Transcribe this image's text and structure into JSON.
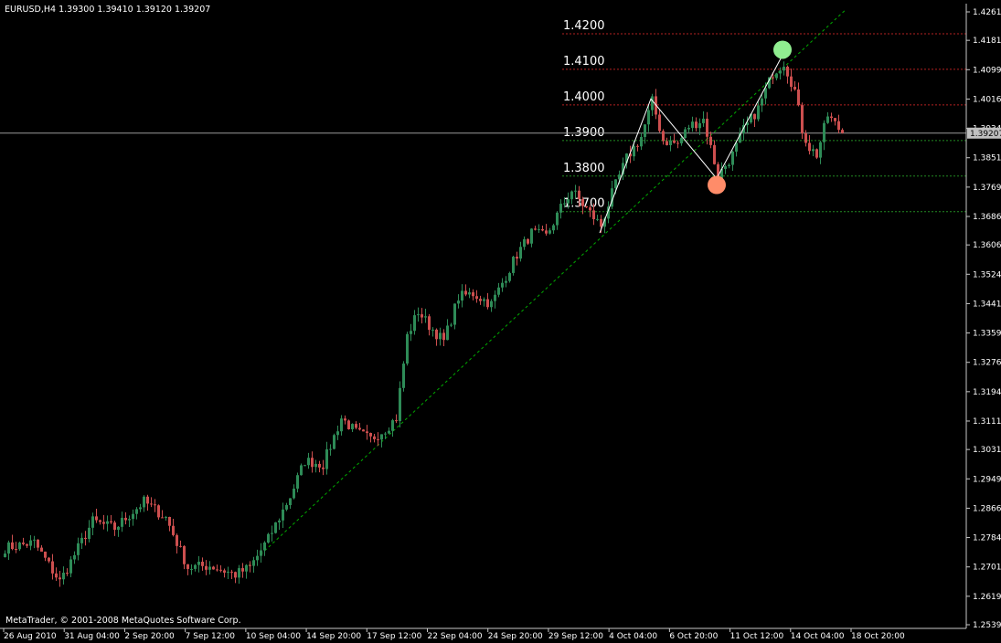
{
  "chart_data": {
    "type": "candlestick",
    "symbol_header": "EURUSD,H4  1.39300 1.39410 1.39120 1.39207",
    "footer": "MetaTrader, © 2001-2008 MetaQuotes Software Corp.",
    "y_axis_ticks": [
      "1.42615",
      "1.41815",
      "1.40990",
      "1.40165",
      "1.39340",
      "1.38515",
      "1.37690",
      "1.36865",
      "1.36065",
      "1.35240",
      "1.34415",
      "1.33590",
      "1.32765",
      "1.31940",
      "1.31115",
      "1.30315",
      "1.29490",
      "1.28665",
      "1.27840",
      "1.27015",
      "1.26190",
      "1.25390"
    ],
    "x_axis_ticks": [
      "26 Aug 2010",
      "31 Aug 04:00",
      "2 Sep 20:00",
      "7 Sep 12:00",
      "10 Sep 04:00",
      "14 Sep 20:00",
      "17 Sep 12:00",
      "22 Sep 04:00",
      "24 Sep 20:00",
      "29 Sep 12:00",
      "4 Oct 04:00",
      "6 Oct 20:00",
      "11 Oct 12:00",
      "14 Oct 04:00",
      "18 Oct 20:00"
    ],
    "current_price_label": "1.39207",
    "ylim": [
      1.2539,
      1.42615
    ],
    "levels": [
      {
        "label": "1.4200",
        "price": 1.42,
        "color": "#b22222"
      },
      {
        "label": "1.4100",
        "price": 1.41,
        "color": "#b22222"
      },
      {
        "label": "1.4000",
        "price": 1.4,
        "color": "#b22222"
      },
      {
        "label": "1.3900",
        "price": 1.39,
        "color": "#228b22"
      },
      {
        "label": "1.3800",
        "price": 1.38,
        "color": "#228b22"
      },
      {
        "label": "1.3700",
        "price": 1.37,
        "color": "#228b22"
      }
    ],
    "pattern_points": [
      {
        "bar": 163,
        "price": 1.364
      },
      {
        "bar": 177,
        "price": 1.4017
      },
      {
        "bar": 195,
        "price": 1.3793
      },
      {
        "bar": 213,
        "price": 1.414
      }
    ],
    "markers": [
      {
        "bar": 213,
        "price": 1.4155,
        "color": "#90ee90"
      },
      {
        "bar": 195,
        "price": 1.3775,
        "color": "#ff8c69"
      }
    ],
    "trendline": {
      "from": {
        "bar": 67,
        "price": 1.2705
      },
      "to": {
        "bar": 230,
        "price": 1.4265
      },
      "color": "#00aa00"
    },
    "bull_color": "#2e8b57",
    "bear_color": "#cd4f4f",
    "waypoints": [
      [
        0,
        1.2755
      ],
      [
        8,
        1.277
      ],
      [
        15,
        1.266
      ],
      [
        24,
        1.283
      ],
      [
        30,
        1.281
      ],
      [
        38,
        1.2885
      ],
      [
        44,
        1.284
      ],
      [
        50,
        1.27
      ],
      [
        56,
        1.2705
      ],
      [
        63,
        1.268
      ],
      [
        67,
        1.27
      ],
      [
        72,
        1.278
      ],
      [
        78,
        1.29
      ],
      [
        82,
        1.3
      ],
      [
        87,
        1.299
      ],
      [
        92,
        1.312
      ],
      [
        96,
        1.308
      ],
      [
        100,
        1.306
      ],
      [
        104,
        1.309
      ],
      [
        107,
        1.312
      ],
      [
        110,
        1.335
      ],
      [
        113,
        1.342
      ],
      [
        116,
        1.338
      ],
      [
        120,
        1.3335
      ],
      [
        124,
        1.346
      ],
      [
        128,
        1.347
      ],
      [
        133,
        1.344
      ],
      [
        136,
        1.35
      ],
      [
        140,
        1.358
      ],
      [
        144,
        1.364
      ],
      [
        148,
        1.363
      ],
      [
        152,
        1.371
      ],
      [
        155,
        1.376
      ],
      [
        158,
        1.372
      ],
      [
        163,
        1.366
      ],
      [
        166,
        1.375
      ],
      [
        170,
        1.385
      ],
      [
        174,
        1.391
      ],
      [
        177,
        1.401
      ],
      [
        180,
        1.39
      ],
      [
        184,
        1.389
      ],
      [
        187,
        1.394
      ],
      [
        191,
        1.396
      ],
      [
        195,
        1.38
      ],
      [
        199,
        1.386
      ],
      [
        202,
        1.393
      ],
      [
        206,
        1.399
      ],
      [
        210,
        1.409
      ],
      [
        213,
        1.412
      ],
      [
        216,
        1.404
      ],
      [
        218,
        1.393
      ],
      [
        220,
        1.388
      ],
      [
        222,
        1.386
      ],
      [
        225,
        1.397
      ],
      [
        229,
        1.3921
      ]
    ],
    "grid": false
  }
}
